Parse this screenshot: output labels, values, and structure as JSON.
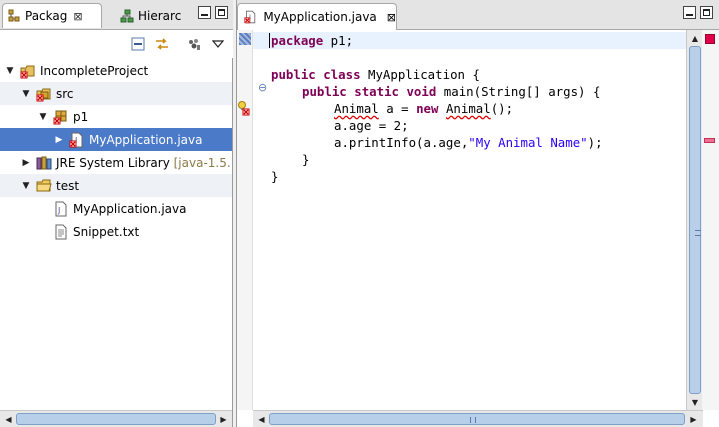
{
  "left_panel": {
    "tabs": [
      {
        "label": "Packag",
        "icon": "package-explorer-icon",
        "active": true
      },
      {
        "label": "Hierarc",
        "icon": "hierarchy-icon",
        "active": false
      }
    ],
    "close_glyph": "⊠",
    "toolbar": [
      "collapse-all-icon",
      "link-with-editor-icon",
      "filter-icon",
      "view-menu-icon"
    ],
    "tree": [
      {
        "label": "IncompleteProject",
        "icon": "java-project-icon",
        "twisty": "▼",
        "depth": 0
      },
      {
        "label": "src",
        "icon": "source-folder-icon",
        "twisty": "▼",
        "depth": 1
      },
      {
        "label": "p1",
        "icon": "package-icon",
        "twisty": "▼",
        "depth": 2
      },
      {
        "label": "MyApplication.java",
        "icon": "java-file-error-icon",
        "twisty": "▶",
        "depth": 3,
        "selected": true
      },
      {
        "label": "JRE System Library",
        "suffix": "[java-1.5.",
        "icon": "library-icon",
        "twisty": "▶",
        "depth": 1
      },
      {
        "label": "test",
        "icon": "folder-icon",
        "twisty": "▼",
        "depth": 1
      },
      {
        "label": "MyApplication.java",
        "icon": "java-file-icon",
        "twisty": "",
        "depth": 2
      },
      {
        "label": "Snippet.txt",
        "icon": "text-file-icon",
        "twisty": "",
        "depth": 2
      }
    ]
  },
  "editor": {
    "tab": {
      "label": "MyApplication.java",
      "close_glyph": "⊠"
    },
    "code": {
      "l1_kw": "package",
      "l1_rest": " p1;",
      "l3_kw1": "public",
      "l3_kw2": "class",
      "l3_rest": " MyApplication {",
      "l4_kw1": "public",
      "l4_kw2": "static",
      "l4_kw3": "void",
      "l4_rest": " main(String[] args) {",
      "l5_type": "Animal",
      "l5_mid": " a = ",
      "l5_kw": "new",
      "l5_ctor": "Animal",
      "l5_end": "();",
      "l6": "a.age = 2;",
      "l7_pre": "a.printInfo(a.age,",
      "l7_str": "\"My Animal Name\"",
      "l7_end": ");",
      "l8": "}",
      "l9": "}"
    },
    "fold_glyph": "⊖"
  },
  "colors": {
    "keyword": "#7f0055",
    "string": "#2a00ff",
    "selection": "#4a7ac8",
    "error": "#e00000"
  }
}
